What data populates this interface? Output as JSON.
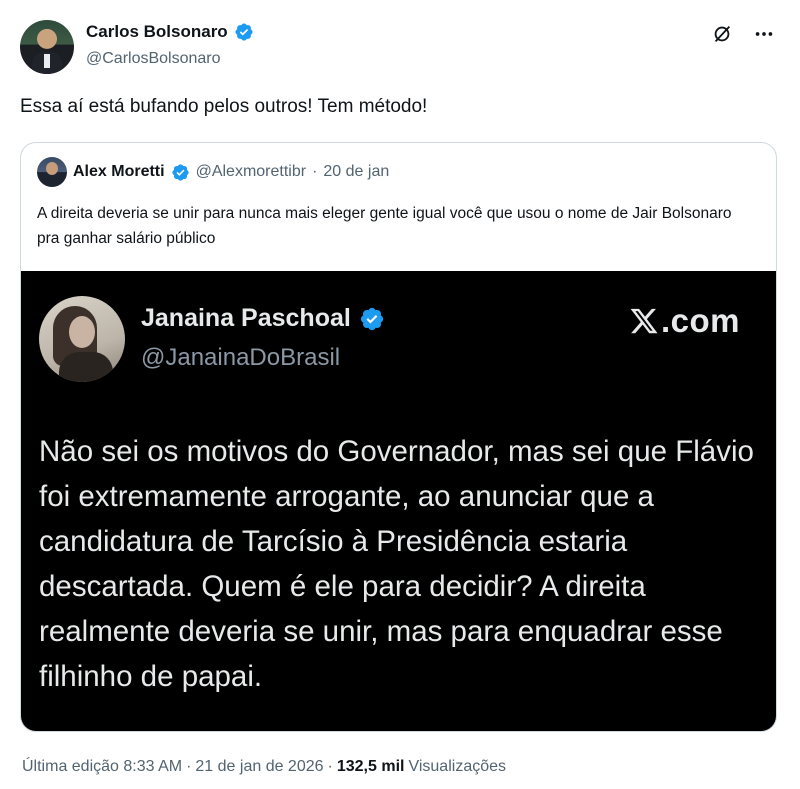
{
  "author": {
    "name": "Carlos Bolsonaro",
    "handle": "@CarlosBolsonaro",
    "verified_color": "#1d9bf0"
  },
  "tweet": {
    "text": "Essa aí está bufando pelos outros! Tem método!"
  },
  "top_icons": [
    "grok-slash-icon",
    "more-icon"
  ],
  "quote": {
    "name": "Alex Moretti",
    "handle": "@Alexmorettibr",
    "dot": "·",
    "date": "20 de jan",
    "text": "A direita deveria se unir para nunca mais eleger gente igual você que usou o nome de Jair Bolsonaro pra ganhar salário público",
    "media": {
      "name": "Janaina Paschoal",
      "handle": "@JanainaDoBrasil",
      "brand": ".com",
      "text": "Não sei os motivos do Governador, mas sei que Flávio foi extremamente arrogante, ao anunciar que a candidatura de Tarcísio à Presidência estaria descartada. Quem é ele para decidir? A direita realmente deveria se unir, mas para enquadrar esse filhinho de papai."
    }
  },
  "footer": {
    "edited": "Última edição 8:33 AM",
    "dot1": "·",
    "date": "21 de jan de 2026",
    "dot2": "·",
    "views_count": "132,5 mil",
    "views_label": "Visualizações"
  }
}
